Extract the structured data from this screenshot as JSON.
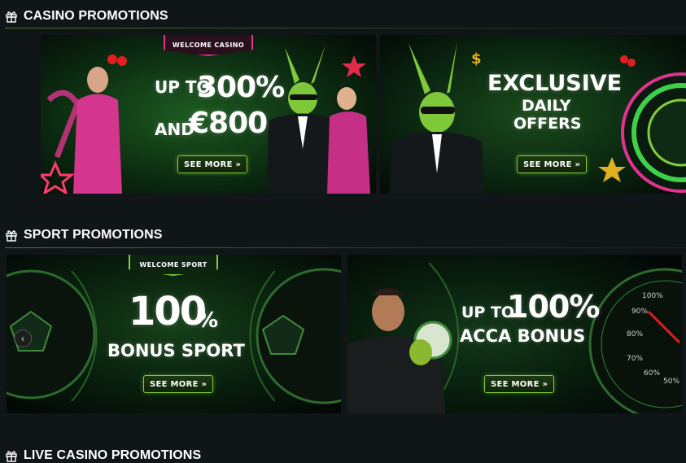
{
  "sections": {
    "casino": {
      "title": "CASINO PROMOTIONS"
    },
    "sport": {
      "title": "SPORT PROMOTIONS"
    },
    "live": {
      "title": "LIVE CASINO PROMOTIONS"
    }
  },
  "casino_banners": [
    {
      "ribbon": "WELCOME CASINO",
      "line1_prefix": "UP TO",
      "line1_value": "300%",
      "line2_prefix": "AND",
      "line2_value": "€800",
      "cta": "SEE MORE »"
    },
    {
      "line1": "EXCLUSIVE",
      "line2": "DAILY",
      "line3": "OFFERS",
      "cta": "SEE MORE »"
    }
  ],
  "sport_banners": [
    {
      "ribbon": "WELCOME SPORT",
      "big": "100",
      "big_suffix": "%",
      "sub": "BONUS SPORT",
      "cta": "SEE MORE »"
    },
    {
      "line1_prefix": "UP TO",
      "line1_value": "100%",
      "line2": "ACCA BONUS",
      "cta": "SEE MORE »",
      "gauge_labels": [
        "100%",
        "90%",
        "80%",
        "70%",
        "60%",
        "50%"
      ]
    }
  ],
  "carousel": {
    "prev_symbol": "‹"
  },
  "colors": {
    "accent": "#7fcf3a",
    "background": "#101517",
    "pink": "#e0338f"
  }
}
